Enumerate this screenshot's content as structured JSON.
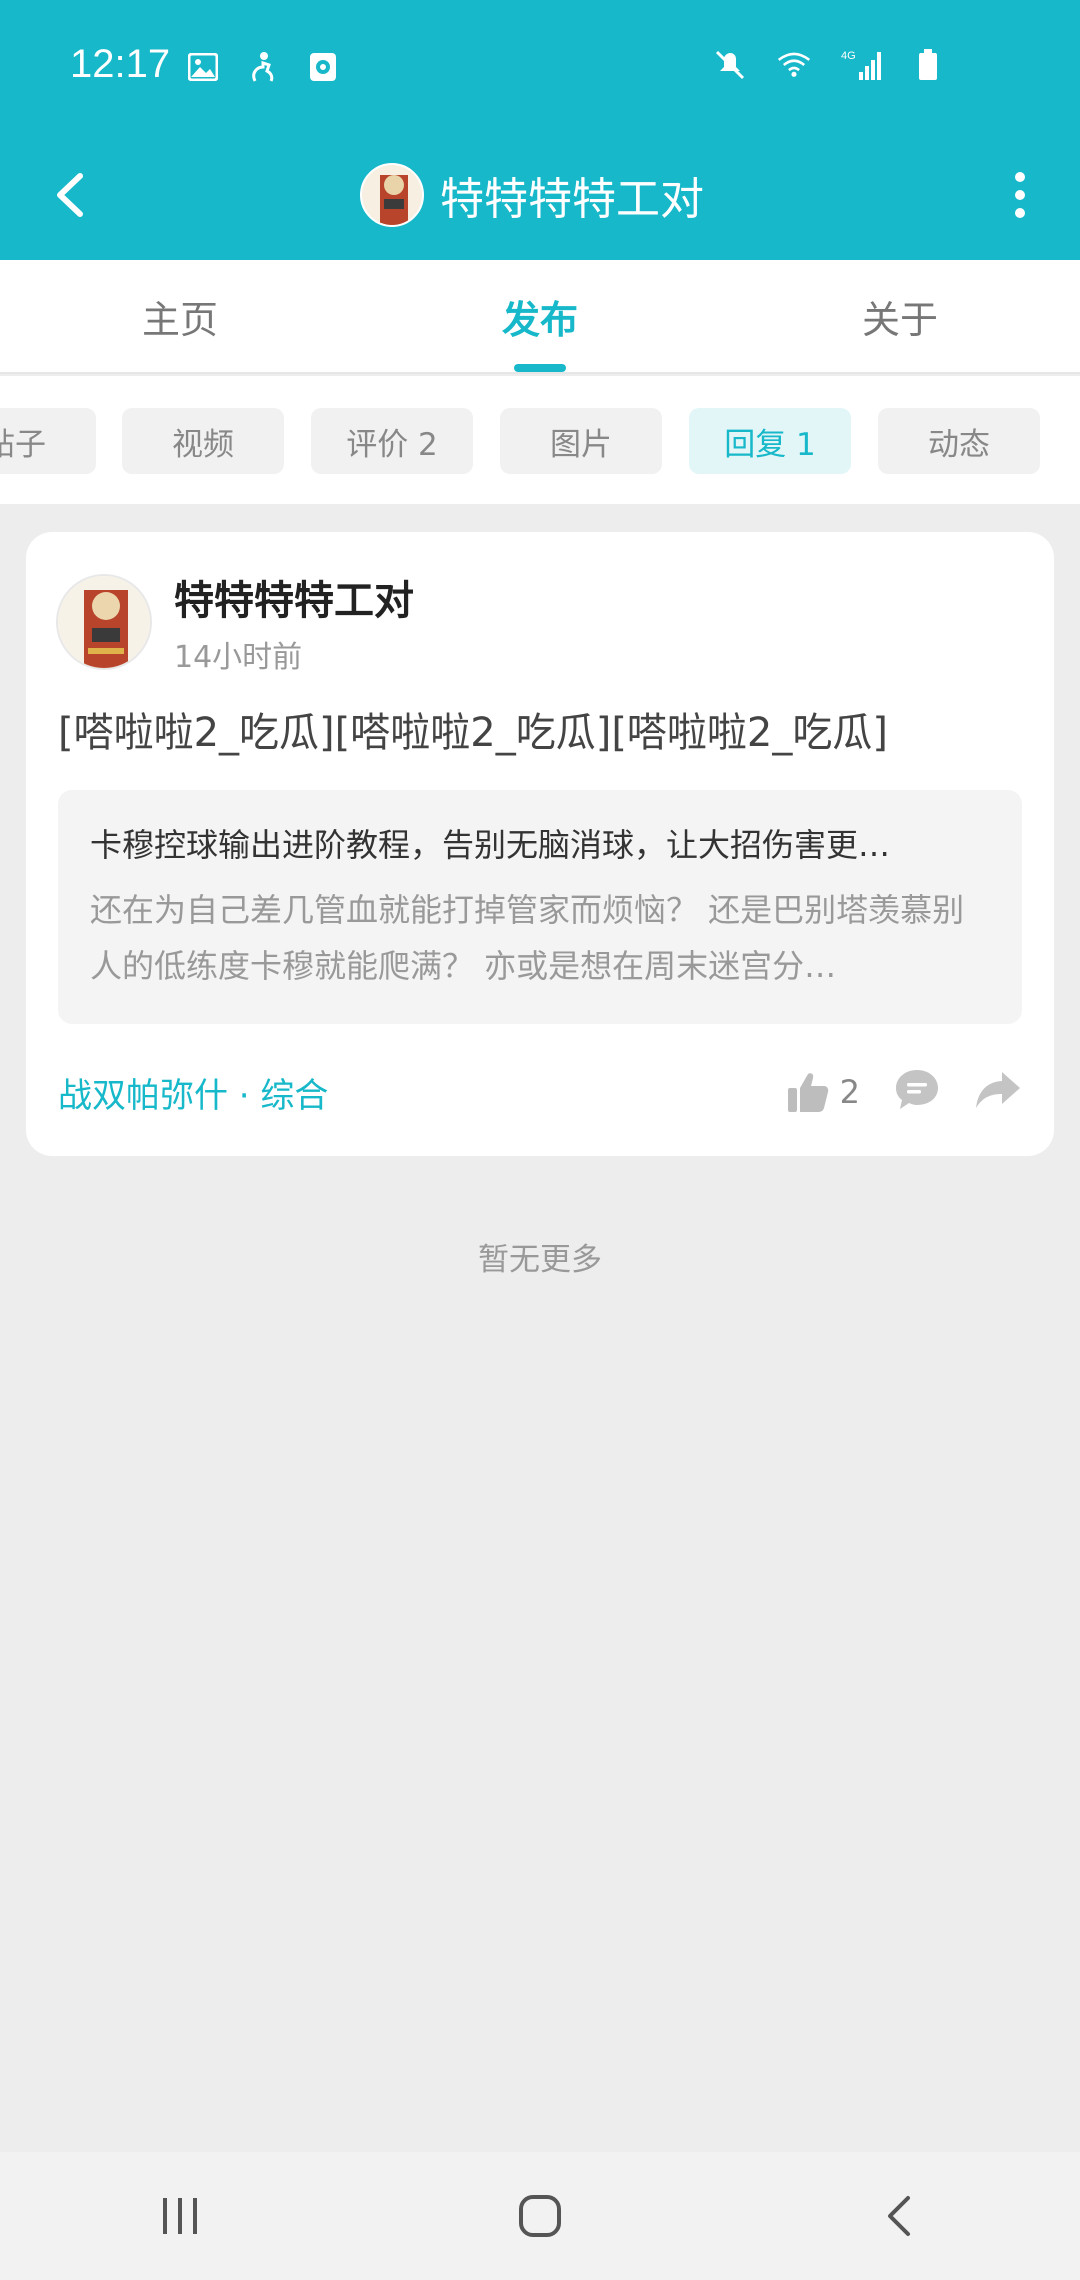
{
  "status_bar": {
    "time": "12:17",
    "left_icons": [
      "image-icon",
      "accessibility-icon",
      "camera-icon"
    ],
    "right_icons": [
      "mute-icon",
      "wifi-icon",
      "4g-signal-icon",
      "battery-icon"
    ],
    "network_label": "4G"
  },
  "header": {
    "title": "特特特特工对",
    "accent_color": "#16b8c9"
  },
  "tabs": [
    {
      "label": "主页",
      "active": false
    },
    {
      "label": "发布",
      "active": true
    },
    {
      "label": "关于",
      "active": false
    }
  ],
  "chips": [
    {
      "label": "帖子",
      "active": false
    },
    {
      "label": "视频",
      "active": false
    },
    {
      "label": "评价 2",
      "active": false
    },
    {
      "label": "图片",
      "active": false
    },
    {
      "label": "回复 1",
      "active": true
    },
    {
      "label": "动态",
      "active": false
    }
  ],
  "post": {
    "username": "特特特特工对",
    "time": "14小时前",
    "text": "[嗒啦啦2_吃瓜][嗒啦啦2_吃瓜][嗒啦啦2_吃瓜]",
    "quote": {
      "title": "卡穆控球输出进阶教程，告别无脑消球，让大招伤害更…",
      "body": "还在为自己差几管血就能打掉管家而烦恼？ 还是巴别塔羡慕别人的低练度卡穆就能爬满？ 亦或是想在周末迷宫分…"
    },
    "forum": "战双帕弥什 · 综合",
    "like_count": "2"
  },
  "no_more": "暂无更多"
}
